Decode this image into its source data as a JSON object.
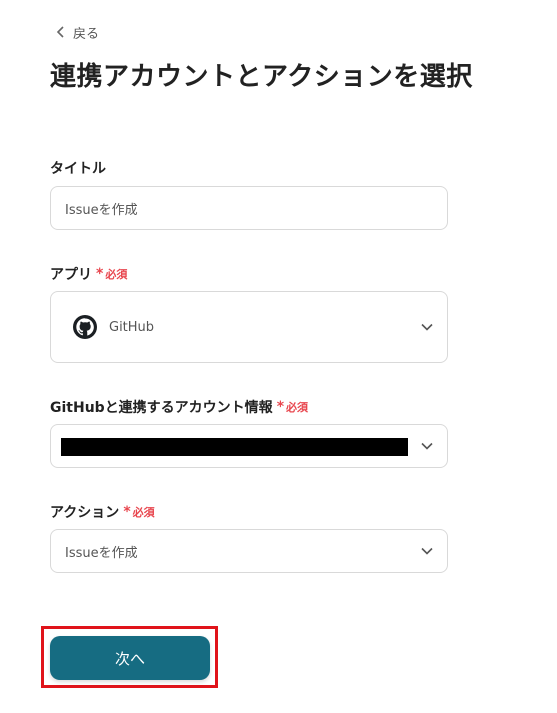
{
  "back": {
    "label": "戻る"
  },
  "page": {
    "title": "連携アカウントとアクションを選択"
  },
  "required_mark": {
    "star": "*",
    "text": "必須"
  },
  "fields": {
    "title": {
      "label": "タイトル",
      "value": "Issueを作成"
    },
    "app": {
      "label": "アプリ",
      "value": "GitHub",
      "icon": "github-icon"
    },
    "account": {
      "label": "GitHubと連携するアカウント情報",
      "value_redacted": true
    },
    "action": {
      "label": "アクション",
      "value": "Issueを作成"
    }
  },
  "next_button": {
    "label": "次へ",
    "color": "#166c82",
    "highlight_color": "#e0131a"
  },
  "colors": {
    "required": "#e8454d"
  }
}
